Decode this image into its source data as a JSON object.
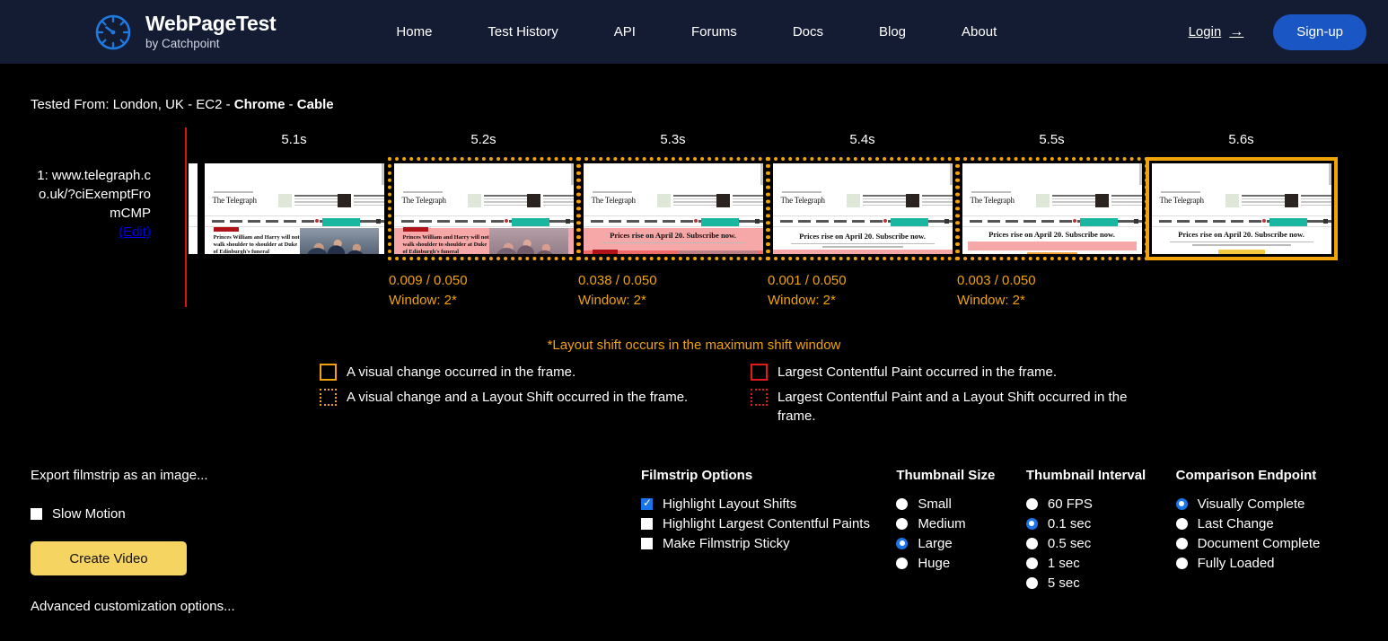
{
  "header": {
    "brand_name": "WebPageTest",
    "brand_sub": "by Catchpoint",
    "logo_icon": "speedometer-icon",
    "nav": [
      {
        "label": "Home"
      },
      {
        "label": "Test History"
      },
      {
        "label": "API"
      },
      {
        "label": "Forums"
      },
      {
        "label": "Docs"
      },
      {
        "label": "Blog"
      },
      {
        "label": "About"
      }
    ],
    "login_label": "Login",
    "login_arrow": "→",
    "signup_label": "Sign-up",
    "accent_color": "#1a56c4",
    "background_color": "#141c34"
  },
  "test_info": {
    "prefix": "Tested From: London, UK - EC2 - ",
    "browser": "Chrome",
    "separator": " - ",
    "connection": "Cable"
  },
  "filmstrip": {
    "step_label_line1": "1: www.telegrap",
    "step_label_line2": "h.co.uk/?ciExem",
    "step_label_line3": "ptFromCMP",
    "step_label_line4": "(Edit)",
    "marker_color": "#d81414",
    "frames": [
      {
        "time": "5.1s",
        "border": "none",
        "shift": "",
        "window": "",
        "variant": "hero"
      },
      {
        "time": "5.2s",
        "border": "dotted",
        "shift": "0.009 / 0.050",
        "window": "Window: 2*",
        "variant": "hero-shift"
      },
      {
        "time": "5.3s",
        "border": "dotted",
        "shift": "0.038 / 0.050",
        "window": "Window: 2*",
        "variant": "banner-shift",
        "banner_text": "Prices rise on April 20. Subscribe now."
      },
      {
        "time": "5.4s",
        "border": "dotted",
        "shift": "0.001 / 0.050",
        "window": "Window: 2*",
        "variant": "banner-clean",
        "banner_text": "Prices rise on April 20. Subscribe now."
      },
      {
        "time": "5.5s",
        "border": "dotted",
        "shift": "0.003 / 0.050",
        "window": "Window: 2*",
        "variant": "banner-shift2",
        "banner_text": "Prices rise on April 20. Subscribe now."
      },
      {
        "time": "5.6s",
        "border": "solid",
        "shift": "",
        "window": "",
        "variant": "banner-final",
        "banner_text": "Prices rise on April 20. Subscribe now."
      }
    ],
    "thumb_site_name": "The Telegraph",
    "thumb_headline": "Princes William and Harry will not walk shoulder to shoulder at Duke of Edinburgh's funeral"
  },
  "legend": {
    "note": "*Layout shift occurs in the maximum shift window",
    "note_color": "#f0a30a",
    "left": [
      {
        "swatch": "y-solid",
        "text": "A visual change occurred in the frame."
      },
      {
        "swatch": "y-dot",
        "text": "A visual change and a Layout Shift occurred in the frame."
      }
    ],
    "right": [
      {
        "swatch": "r-solid",
        "text": "Largest Contentful Paint occurred in the frame."
      },
      {
        "swatch": "r-dot",
        "text": "Largest Contentful Paint and a Layout Shift occurred in the frame."
      }
    ]
  },
  "controls": {
    "export_label": "Export filmstrip as an image...",
    "slow_motion_label": "Slow Motion",
    "slow_motion_checked": false,
    "create_video_label": "Create Video",
    "create_video_color": "#f5d462",
    "advanced_label": "Advanced customization options..."
  },
  "options": {
    "filmstrip": {
      "title": "Filmstrip Options",
      "items": [
        {
          "label": "Highlight Layout Shifts",
          "checked": true
        },
        {
          "label": "Highlight Largest Contentful Paints",
          "checked": false
        },
        {
          "label": "Make Filmstrip Sticky",
          "checked": false
        }
      ]
    },
    "size": {
      "title": "Thumbnail Size",
      "items": [
        {
          "label": "Small",
          "selected": false
        },
        {
          "label": "Medium",
          "selected": false
        },
        {
          "label": "Large",
          "selected": true
        },
        {
          "label": "Huge",
          "selected": false
        }
      ]
    },
    "interval": {
      "title": "Thumbnail Interval",
      "items": [
        {
          "label": "60 FPS",
          "selected": false
        },
        {
          "label": "0.1 sec",
          "selected": true
        },
        {
          "label": "0.5 sec",
          "selected": false
        },
        {
          "label": "1 sec",
          "selected": false
        },
        {
          "label": "5 sec",
          "selected": false
        }
      ]
    },
    "endpoint": {
      "title": "Comparison Endpoint",
      "items": [
        {
          "label": "Visually Complete",
          "selected": true
        },
        {
          "label": "Last Change",
          "selected": false
        },
        {
          "label": "Document Complete",
          "selected": false
        },
        {
          "label": "Fully Loaded",
          "selected": false
        }
      ]
    },
    "selected_color": "#1a73e8"
  }
}
